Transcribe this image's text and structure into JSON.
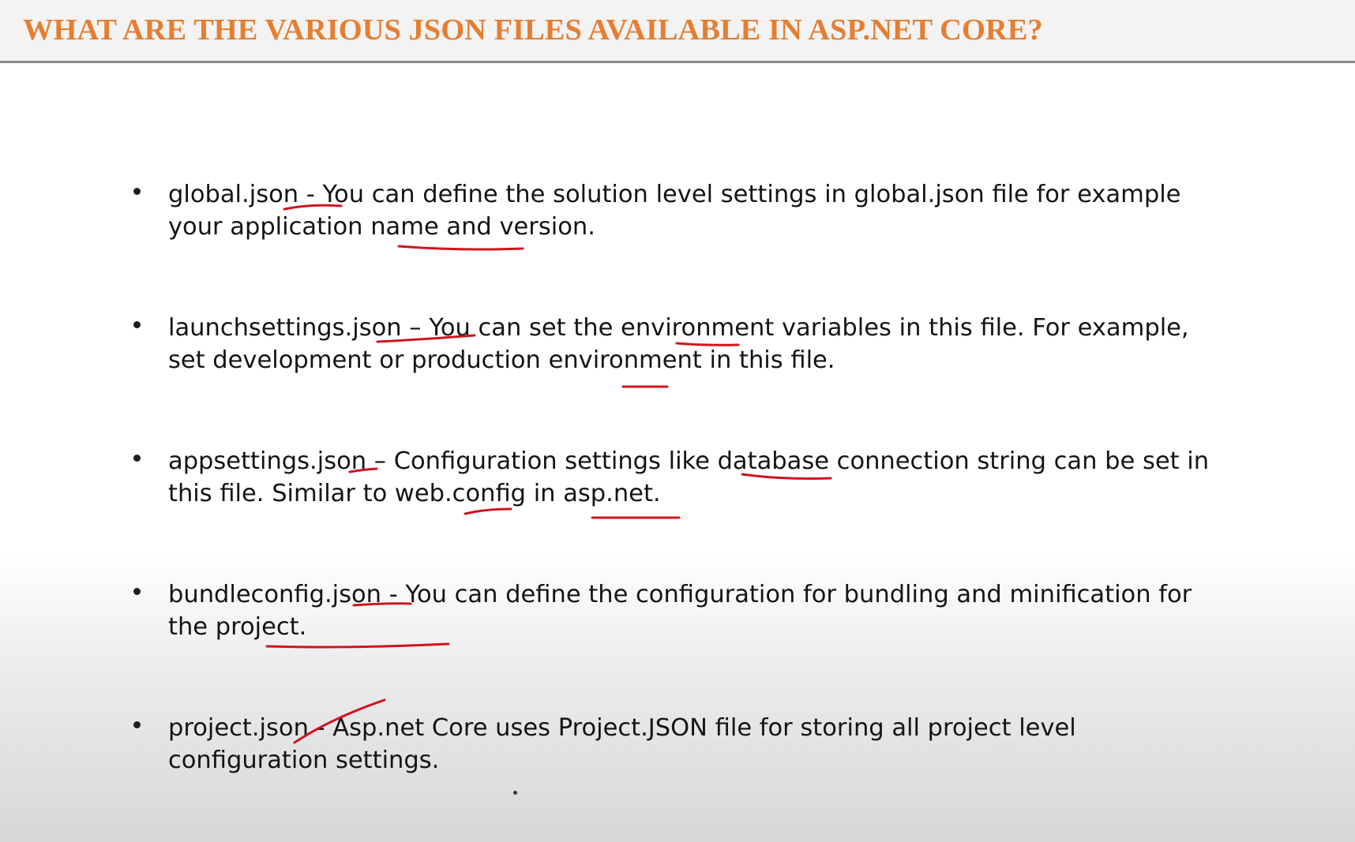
{
  "slide": {
    "title": "WHAT ARE THE VARIOUS JSON FILES AVAILABLE IN ASP.NET CORE?",
    "items": [
      "global.json - You can define the solution level settings in global.json file for example your application name and version.",
      "launchsettings.json – You can set the environment variables in this file. For example, set development or production environment in this file.",
      "appsettings.json – Configuration settings like database connection string can be set in this file. Similar to web.config in asp.net.",
      "bundleconfig.json - You can define the configuration for bundling and minification for the project.",
      "project.json - Asp.net Core uses Project.JSON file for storing all project level configuration settings."
    ]
  },
  "colors": {
    "title": "#e67e31",
    "text": "#141414",
    "annotation_ink": "#d0141c"
  }
}
